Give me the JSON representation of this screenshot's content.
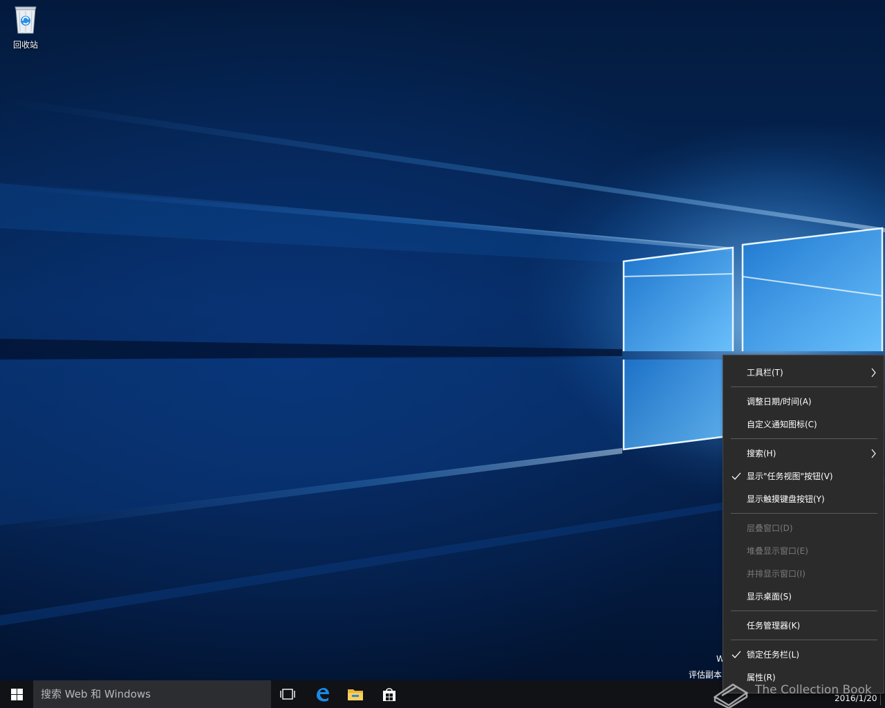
{
  "desktop": {
    "recycle_bin_label": "回收站",
    "eval_line1": "W",
    "eval_line2": "评估副本"
  },
  "taskbar": {
    "search_placeholder": "搜索 Web 和 Windows",
    "date": "2016/1/20",
    "pinned": [
      {
        "name": "task-view-icon"
      },
      {
        "name": "edge-icon"
      },
      {
        "name": "file-explorer-icon"
      },
      {
        "name": "store-icon"
      }
    ]
  },
  "context_menu": {
    "items": [
      {
        "label": "工具栏(T)",
        "submenu": true,
        "checked": false,
        "disabled": false
      },
      {
        "label": "调整日期/时间(A)",
        "submenu": false,
        "checked": false,
        "disabled": false
      },
      {
        "label": "自定义通知图标(C)",
        "submenu": false,
        "checked": false,
        "disabled": false
      },
      {
        "label": "搜索(H)",
        "submenu": true,
        "checked": false,
        "disabled": false
      },
      {
        "label": "显示\"任务视图\"按钮(V)",
        "submenu": false,
        "checked": true,
        "disabled": false
      },
      {
        "label": "显示触摸键盘按钮(Y)",
        "submenu": false,
        "checked": false,
        "disabled": false
      },
      {
        "label": "层叠窗口(D)",
        "submenu": false,
        "checked": false,
        "disabled": true
      },
      {
        "label": "堆叠显示窗口(E)",
        "submenu": false,
        "checked": false,
        "disabled": true
      },
      {
        "label": "并排显示窗口(I)",
        "submenu": false,
        "checked": false,
        "disabled": true
      },
      {
        "label": "显示桌面(S)",
        "submenu": false,
        "checked": false,
        "disabled": false
      },
      {
        "label": "任务管理器(K)",
        "submenu": false,
        "checked": false,
        "disabled": false
      },
      {
        "label": "锁定任务栏(L)",
        "submenu": false,
        "checked": true,
        "disabled": false
      },
      {
        "label": "属性(R)",
        "submenu": false,
        "checked": false,
        "disabled": false
      }
    ]
  },
  "watermark": {
    "text": "The Collection Book"
  },
  "colors": {
    "menu_bg": "#2b2b2b",
    "taskbar_bg": "#101216",
    "search_bg": "#2b2d31",
    "accent": "#0078d7"
  }
}
